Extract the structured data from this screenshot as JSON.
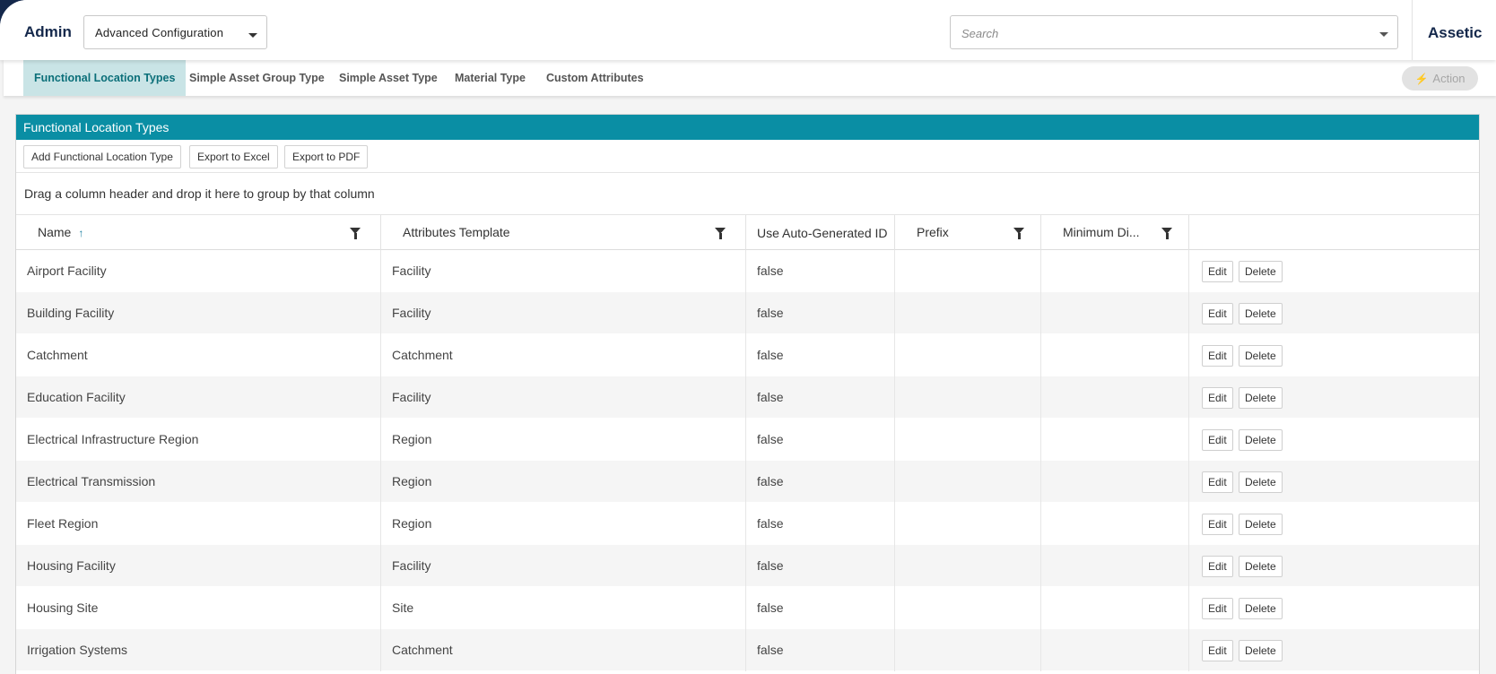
{
  "header": {
    "section_title": "Admin",
    "config_select": "Advanced Configuration",
    "search_placeholder": "Search",
    "brand": "Assetic"
  },
  "subnav": {
    "tabs": [
      {
        "label": "Functional Location Types",
        "active": true
      },
      {
        "label": "Simple Asset Group Type",
        "active": false
      },
      {
        "label": "Simple Asset Type",
        "active": false
      },
      {
        "label": "Material Type",
        "active": false
      },
      {
        "label": "Custom Attributes",
        "active": false
      }
    ],
    "action_label": "Action"
  },
  "panel": {
    "title": "Functional Location Types",
    "toolbar": {
      "add_label": "Add Functional Location Type",
      "excel_label": "Export to Excel",
      "pdf_label": "Export to PDF"
    },
    "group_hint": "Drag a column header and drop it here to group by that column",
    "columns": [
      "Name",
      "Attributes Template",
      "Use Auto-Generated ID",
      "Prefix",
      "Minimum Di..."
    ],
    "sort_indicator": "↑",
    "row_actions": {
      "edit": "Edit",
      "delete": "Delete"
    },
    "rows": [
      {
        "name": "Airport Facility",
        "template": "Facility",
        "auto_id": "false",
        "prefix": "",
        "min_digits": ""
      },
      {
        "name": "Building Facility",
        "template": "Facility",
        "auto_id": "false",
        "prefix": "",
        "min_digits": ""
      },
      {
        "name": "Catchment",
        "template": "Catchment",
        "auto_id": "false",
        "prefix": "",
        "min_digits": ""
      },
      {
        "name": "Education Facility",
        "template": "Facility",
        "auto_id": "false",
        "prefix": "",
        "min_digits": ""
      },
      {
        "name": "Electrical Infrastructure Region",
        "template": "Region",
        "auto_id": "false",
        "prefix": "",
        "min_digits": ""
      },
      {
        "name": "Electrical Transmission",
        "template": "Region",
        "auto_id": "false",
        "prefix": "",
        "min_digits": ""
      },
      {
        "name": "Fleet Region",
        "template": "Region",
        "auto_id": "false",
        "prefix": "",
        "min_digits": ""
      },
      {
        "name": "Housing Facility",
        "template": "Facility",
        "auto_id": "false",
        "prefix": "",
        "min_digits": ""
      },
      {
        "name": "Housing Site",
        "template": "Site",
        "auto_id": "false",
        "prefix": "",
        "min_digits": ""
      },
      {
        "name": "Irrigation Systems",
        "template": "Catchment",
        "auto_id": "false",
        "prefix": "",
        "min_digits": ""
      }
    ]
  },
  "colors": {
    "navy": "#14284b",
    "panel_header": "#0a8ea4",
    "active_tab_bg": "#c9e4e6",
    "active_tab_text": "#0b6f79"
  }
}
